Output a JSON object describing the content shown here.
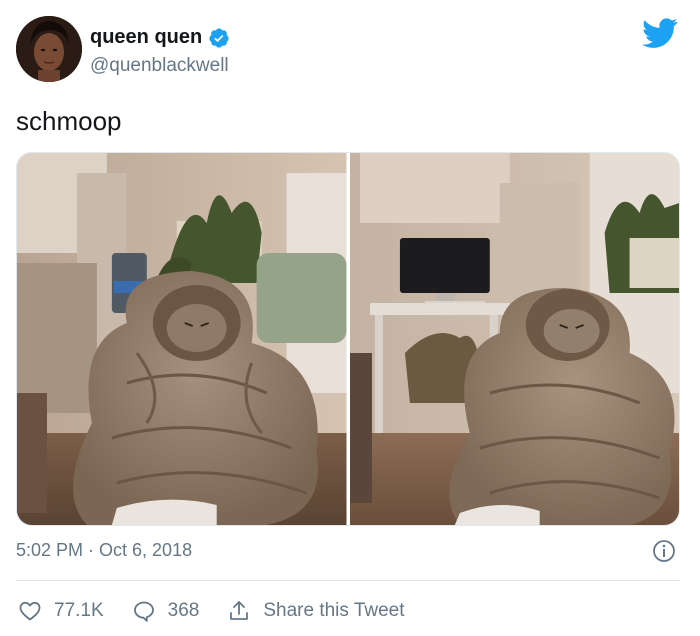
{
  "tweet": {
    "author": {
      "display_name": "queen quen",
      "handle": "@quenblackwell",
      "verified": true
    },
    "text": "schmoop",
    "media": [
      {
        "description": "cat wrapped in a tan blanket next to a plant"
      },
      {
        "description": "cat wrapped in a tan blanket in front of a desk with a monitor"
      }
    ],
    "timestamp": "5:02 PM · Oct 6, 2018",
    "actions": {
      "likes": "77.1K",
      "replies": "368",
      "share_label": "Share this Tweet"
    }
  },
  "colors": {
    "brand_blue": "#1da1f2",
    "secondary_text": "#657786",
    "primary_text": "#14171a"
  },
  "icons": [
    "twitter-bird-icon",
    "verified-badge-icon",
    "info-icon",
    "heart-icon",
    "reply-bubble-icon",
    "share-icon"
  ]
}
